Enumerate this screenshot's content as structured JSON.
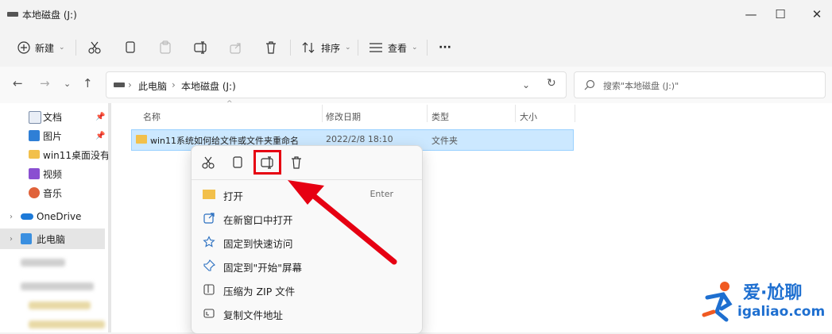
{
  "window": {
    "title": "本地磁盘 (J:)"
  },
  "toolbar": {
    "new_label": "新建",
    "sort_label": "排序",
    "view_label": "查看",
    "more_label": "···"
  },
  "address": {
    "crumbs": [
      "此电脑",
      "本地磁盘 (J:)"
    ],
    "search_placeholder": "搜索\"本地磁盘 (J:)\""
  },
  "sidebar": {
    "items": [
      {
        "label": "文档",
        "icon": "document-icon",
        "pinned": true
      },
      {
        "label": "图片",
        "icon": "picture-icon",
        "pinned": true
      },
      {
        "label": "win11桌面没有",
        "icon": "folder-icon",
        "pinned": false
      },
      {
        "label": "视频",
        "icon": "video-icon",
        "pinned": false
      },
      {
        "label": "音乐",
        "icon": "music-icon",
        "pinned": false
      },
      {
        "label": "OneDrive",
        "icon": "cloud-icon",
        "pinned": false
      },
      {
        "label": "此电脑",
        "icon": "computer-icon",
        "pinned": false
      }
    ]
  },
  "file_list": {
    "columns": [
      "名称",
      "修改日期",
      "类型",
      "大小"
    ],
    "rows": [
      {
        "name": "win11系统如何给文件或文件夹重命名",
        "modified": "2022/2/8 18:10",
        "type": "文件夹",
        "size": ""
      }
    ]
  },
  "context_menu": {
    "items": [
      {
        "label": "打开",
        "shortcut": "Enter",
        "icon": "folder-open-icon"
      },
      {
        "label": "在新窗口中打开",
        "shortcut": "",
        "icon": "new-window-icon"
      },
      {
        "label": "固定到快速访问",
        "shortcut": "",
        "icon": "star-icon"
      },
      {
        "label": "固定到\"开始\"屏幕",
        "shortcut": "",
        "icon": "pin-icon"
      },
      {
        "label": "压缩为 ZIP 文件",
        "shortcut": "",
        "icon": "zip-icon"
      },
      {
        "label": "复制文件地址",
        "shortcut": "",
        "icon": "copy-path-icon"
      }
    ]
  },
  "watermark": {
    "brand": "爱·尬聊",
    "domain": "igaliao.com"
  },
  "colors": {
    "accent": "#0067c0",
    "selection": "#cce8ff",
    "highlight": "#e60012",
    "folder": "#f2c04b"
  }
}
